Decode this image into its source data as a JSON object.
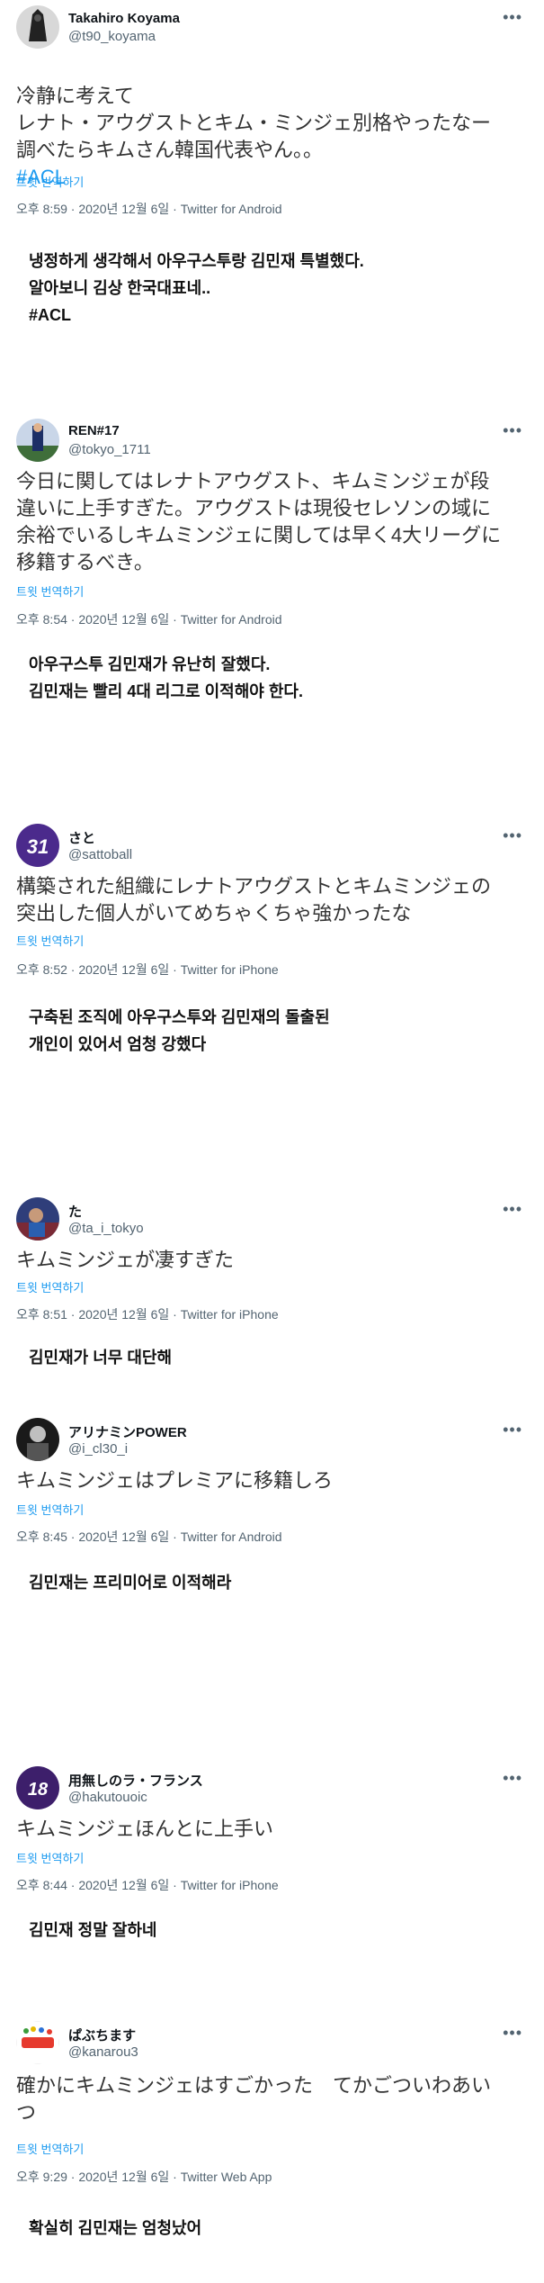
{
  "ui": {
    "translate_label": "트윗 번역하기",
    "more_label": "•••"
  },
  "tweets": [
    {
      "name": "Takahiro Koyama",
      "handle": "@t90_koyama",
      "text": "冷静に考えて\nレナト・アウグストとキム・ミンジェ別格やったなー\n調べたらキムさん韓国代表やん。。",
      "hashtag": "#ACL",
      "meta": "오후 8:59 · 2020년 12월 6일 · Twitter for Android",
      "korean": "냉정하게 생각해서 아우구스투랑 김민재 특별했다.\n알아보니 김상 한국대표네..\n#ACL"
    },
    {
      "name": "REN#17",
      "handle": "@tokyo_1711",
      "text": "今日に関してはレナトアウグスト、キムミンジェが段\n違いに上手すぎた。アウグストは現役セレソンの域に\n余裕でいるしキムミンジェに関しては早く4大リーグに\n移籍するべき。",
      "meta": "오후 8:54 · 2020년 12월 6일 · Twitter for Android",
      "korean": "아우구스투 김민재가 유난히 잘했다.\n김민재는 빨리 4대 리그로 이적해야 한다."
    },
    {
      "name": "さと",
      "handle": "@sattoball",
      "text": "構築された組織にレナトアウグストとキムミンジェの\n突出した個人がいてめちゃくちゃ強かったな",
      "meta": "오후 8:52 · 2020년 12월 6일 · Twitter for iPhone",
      "korean": "구축된 조직에 아우구스투와 김민재의 돌출된\n개인이 있어서 엄청 강했다"
    },
    {
      "name": "た",
      "handle": "@ta_i_tokyo",
      "text": "キムミンジェが凄すぎた",
      "meta": "오후 8:51 · 2020년 12월 6일 · Twitter for iPhone",
      "korean": "김민재가 너무 대단해"
    },
    {
      "name": "アリナミンPOWER",
      "handle": "@i_cl30_i",
      "text": "キムミンジェはプレミアに移籍しろ",
      "meta": "오후 8:45 · 2020년 12월 6일 · Twitter for Android",
      "korean": "김민재는 프리미어로 이적해라"
    },
    {
      "name": "用無しのラ・フランス",
      "handle": "@hakutouoic",
      "text": "キムミンジェほんとに上手い",
      "meta": "오후 8:44 · 2020년 12월 6일 · Twitter for iPhone",
      "korean": "김민재 정말 잘하네"
    },
    {
      "name": "ぱぶちます",
      "handle": "@kanarou3",
      "text": "確かにキムミンジェはすごかった　てかごついわあい\nつ",
      "meta": "오후 9:29 · 2020년 12월 6일 · Twitter Web App",
      "korean": "확실히 김민재는 엄청났어"
    }
  ]
}
